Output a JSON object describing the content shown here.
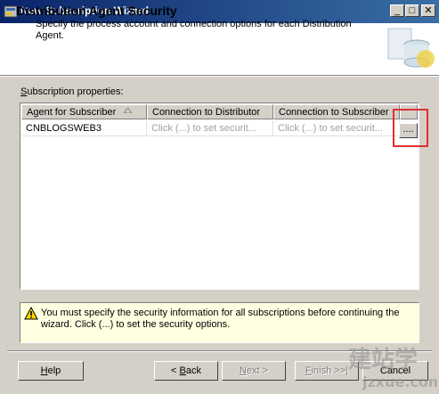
{
  "window": {
    "title": "New Subscription Wizard"
  },
  "header": {
    "title": "Distribution Agent Security",
    "subtitle": "Specify the process account and connection options for each Distribution Agent."
  },
  "subscriptions": {
    "label_access": "S",
    "label_rest": "ubscription properties:",
    "columns": [
      "Agent for Subscriber",
      "Connection to Distributor",
      "Connection to Subscriber"
    ],
    "rows": [
      {
        "agent": "CNBLOGSWEB3",
        "distributor": "Click (...) to set securit...",
        "subscriber": "Click (...) to set securit..."
      }
    ],
    "ellipsis_label": "...."
  },
  "warning": {
    "text": "You must specify the security information for all subscriptions before continuing the wizard. Click (...) to set the security options."
  },
  "buttons": {
    "help": {
      "access": "H",
      "rest": "elp"
    },
    "back_prefix": "< ",
    "back": {
      "access": "B",
      "rest": "ack"
    },
    "next": {
      "access": "N",
      "rest": "ext >"
    },
    "finish": {
      "access": "F",
      "rest": "inish >>|"
    },
    "cancel": "Cancel"
  },
  "watermark": {
    "text": "jzxue.com"
  },
  "icons": {
    "app": "wizard-app-icon",
    "minimize": "minimize-icon",
    "maximize": "maximize-icon",
    "close": "close-icon",
    "header": "database-header-icon",
    "warning": "warning-icon",
    "sort": "sort-ascending-icon"
  },
  "colors": {
    "titlebar": "#0a246a",
    "highlight": "#e03030",
    "warning_bg": "#ffffe1"
  }
}
